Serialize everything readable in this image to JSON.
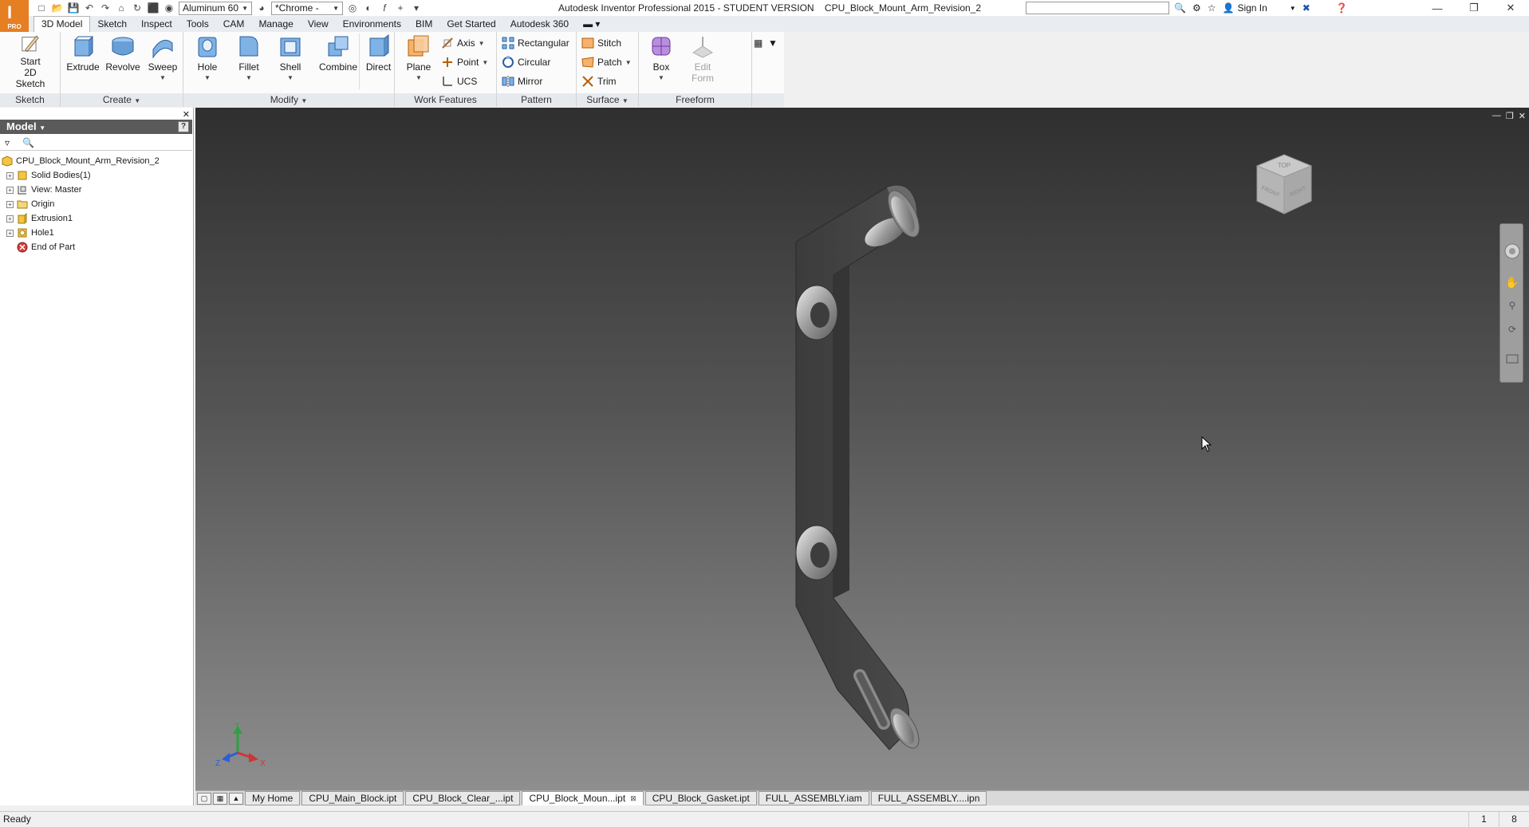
{
  "window": {
    "title": "Autodesk Inventor Professional 2015 - STUDENT VERSION    CPU_Block_Mount_Arm_Revision_2",
    "logo_label": "PRO",
    "sign_in": "Sign In",
    "search_value": ""
  },
  "qat": {
    "material": "Aluminum 60",
    "appearance": "*Chrome -"
  },
  "ribbon_tabs": [
    "3D Model",
    "Sketch",
    "Inspect",
    "Tools",
    "CAM",
    "Manage",
    "View",
    "Environments",
    "BIM",
    "Get Started",
    "Autodesk 360"
  ],
  "ribbon": {
    "sketch": {
      "start_label_1": "Start",
      "start_label_2": "2D Sketch",
      "panel": "Sketch"
    },
    "create": {
      "extrude": "Extrude",
      "revolve": "Revolve",
      "sweep": "Sweep",
      "panel": "Create"
    },
    "modify": {
      "hole": "Hole",
      "fillet": "Fillet",
      "shell": "Shell",
      "combine": "Combine",
      "direct": "Direct",
      "panel": "Modify"
    },
    "work": {
      "plane": "Plane",
      "axis": "Axis",
      "point": "Point",
      "ucs": "UCS",
      "panel": "Work Features"
    },
    "pattern": {
      "rectangular": "Rectangular",
      "circular": "Circular",
      "mirror": "Mirror",
      "panel": "Pattern"
    },
    "surface": {
      "stitch": "Stitch",
      "patch": "Patch",
      "trim": "Trim",
      "panel": "Surface"
    },
    "freeform": {
      "box": "Box",
      "edit_1": "Edit",
      "edit_2": "Form",
      "panel": "Freeform"
    }
  },
  "browser": {
    "header": "Model",
    "root": "CPU_Block_Mount_Arm_Revision_2",
    "items": [
      {
        "label": "Solid Bodies(1)"
      },
      {
        "label": "View: Master"
      },
      {
        "label": "Origin"
      },
      {
        "label": "Extrusion1"
      },
      {
        "label": "Hole1"
      },
      {
        "label": "End of Part"
      }
    ]
  },
  "doc_tabs": [
    "My Home",
    "CPU_Main_Block.ipt",
    "CPU_Block_Clear_...ipt",
    "CPU_Block_Moun...ipt",
    "CPU_Block_Gasket.ipt",
    "FULL_ASSEMBLY.iam",
    "FULL_ASSEMBLY....ipn"
  ],
  "active_doc_tab": "CPU_Block_Moun...ipt",
  "status": {
    "text": "Ready",
    "count_1": "1",
    "count_2": "8"
  },
  "viewcube": {
    "top": "TOP",
    "front": "FRONT",
    "right": "RIGHT"
  },
  "triad": {
    "x": "X",
    "y": "Y",
    "z": "Z"
  },
  "colors": {
    "accent": "#e67e22",
    "viewport_top": "#2f2f2f",
    "viewport_bottom": "#8e8e8e",
    "ribbon_bg": "#fbfbfb"
  }
}
